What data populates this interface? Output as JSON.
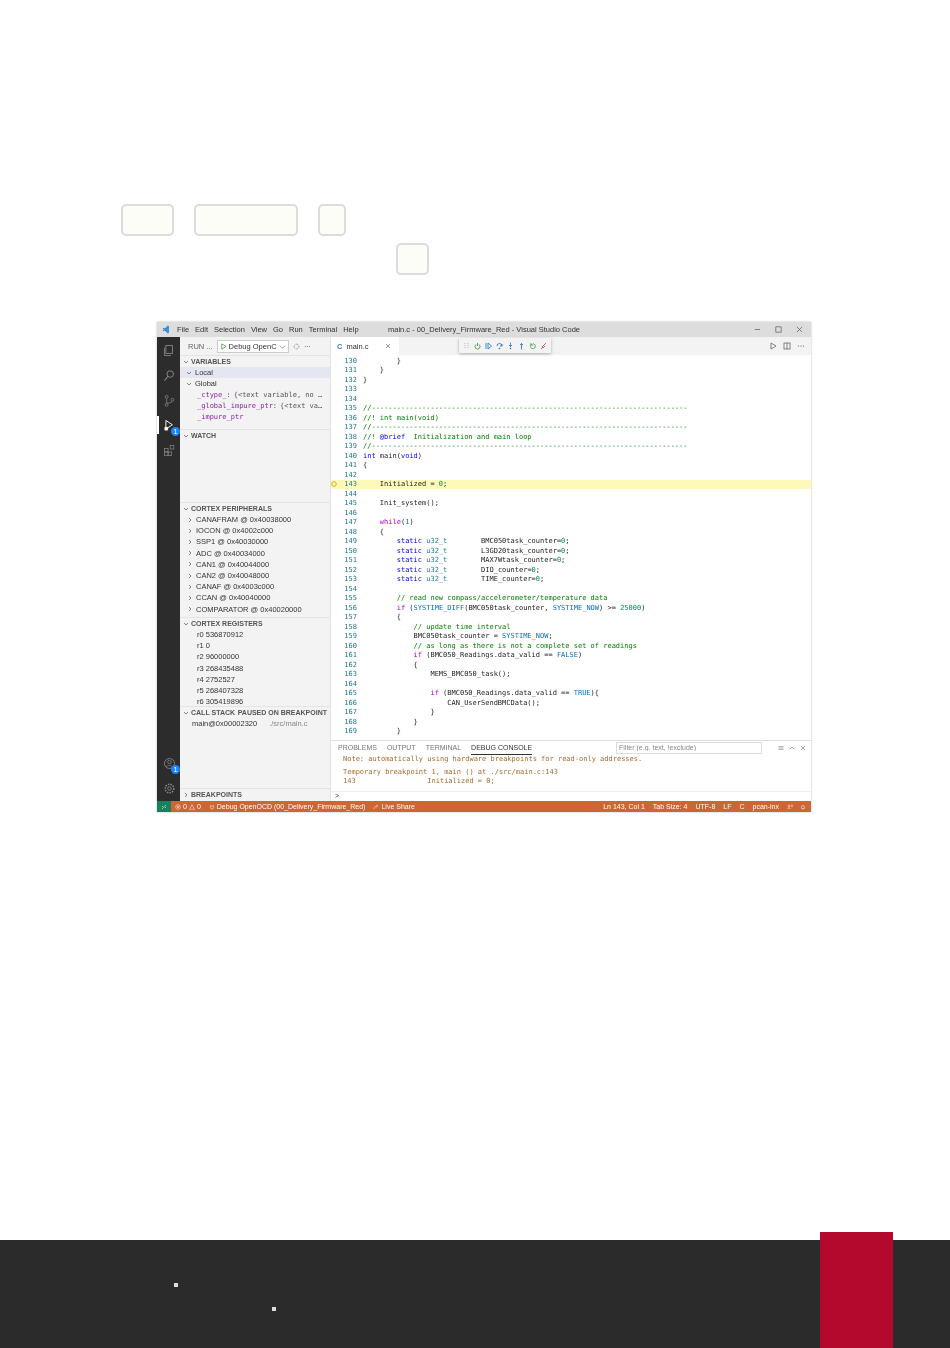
{
  "window": {
    "title": "main.c - 00_Delivery_Firmware_Red - Visual Studio Code",
    "menu": [
      "File",
      "Edit",
      "Selection",
      "View",
      "Go",
      "Run",
      "Terminal",
      "Help"
    ]
  },
  "activity_bar": {
    "top": [
      {
        "kind": "explorer",
        "selected": false
      },
      {
        "kind": "search",
        "selected": false
      },
      {
        "kind": "source-control",
        "selected": false
      },
      {
        "kind": "run-debug",
        "selected": true,
        "badge": "1"
      },
      {
        "kind": "extensions",
        "selected": false
      }
    ],
    "bottom": [
      {
        "kind": "accounts",
        "selected": false,
        "badge": "1"
      },
      {
        "kind": "settings",
        "selected": false
      }
    ]
  },
  "sidebar": {
    "title": "RUN ...",
    "config": "Debug OpenC",
    "sections": [
      {
        "kind": "variables",
        "title": "VARIABLES",
        "expanded": true,
        "items": [
          {
            "label": "Local",
            "expanded": true
          },
          {
            "label": "Global",
            "expanded": true,
            "children": [
              {
                "name": "_ctype_:",
                "value": "{<text variable, no …"
              },
              {
                "name": "_global_impure_ptr:",
                "value": "{<text va…"
              },
              {
                "name": "_impure_ptr"
              }
            ]
          }
        ]
      },
      {
        "kind": "watch",
        "title": "WATCH",
        "expanded": true
      },
      {
        "kind": "tree",
        "title": "CORTEX PERIPHERALS",
        "expanded": true,
        "items": [
          {
            "label": "CANAFRAM @ 0x40038000",
            "expanded": false
          },
          {
            "label": "IOCON @ 0x4002c000",
            "expanded": false
          },
          {
            "label": "SSP1 @ 0x40030000",
            "expanded": false
          },
          {
            "label": "ADC @ 0x40034000",
            "expanded": false
          },
          {
            "label": "CAN1 @ 0x40044000",
            "expanded": false
          },
          {
            "label": "CAN2 @ 0x40048000",
            "expanded": false
          },
          {
            "label": "CANAF @ 0x4003c000",
            "expanded": false
          },
          {
            "label": "CCAN @ 0x40040000",
            "expanded": false
          },
          {
            "label": "COMPARATOR @ 0x40020000",
            "expanded": false
          }
        ]
      },
      {
        "kind": "registers",
        "title": "CORTEX REGISTERS",
        "expanded": true,
        "items": [
          {
            "label": "r0 536870912"
          },
          {
            "label": "r1 0"
          },
          {
            "label": "r2 96000000"
          },
          {
            "label": "r3 268435488"
          },
          {
            "label": "r4 2752527"
          },
          {
            "label": "r5 268407328"
          },
          {
            "label": "r6 305419896"
          }
        ]
      },
      {
        "kind": "call-stack",
        "title": "CALL STACK",
        "expanded": true,
        "status": "PAUSED ON BREAKPOINT",
        "frames": [
          {
            "function": "main@0x00002320",
            "file": "./src/main.c"
          }
        ]
      },
      {
        "kind": "breakpoints",
        "title": "BREAKPOINTS",
        "expanded": false
      }
    ]
  },
  "editor": {
    "tab": {
      "language": "C",
      "label": "main.c"
    },
    "lines": [
      {
        "number": "130",
        "current": false,
        "segments": [
          {
            "kind": "plain",
            "text": "        }"
          }
        ]
      },
      {
        "number": "131",
        "current": false,
        "segments": [
          {
            "kind": "plain",
            "text": "    }"
          }
        ]
      },
      {
        "number": "132",
        "current": false,
        "segments": [
          {
            "kind": "plain",
            "text": "}"
          }
        ]
      },
      {
        "number": "133",
        "current": false
      },
      {
        "number": "134",
        "current": false
      },
      {
        "number": "135",
        "current": false,
        "segments": [
          {
            "kind": "comment",
            "text": "//---------------------------------------------------------------------------"
          }
        ]
      },
      {
        "number": "136",
        "current": false,
        "segments": [
          {
            "kind": "comment",
            "text": "//! int main(void)"
          }
        ]
      },
      {
        "number": "137",
        "current": false,
        "segments": [
          {
            "kind": "comment",
            "text": "//---------------------------------------------------------------------------"
          }
        ]
      },
      {
        "number": "138",
        "current": false,
        "segments": [
          {
            "kind": "comment",
            "text": "//! "
          },
          {
            "kind": "doc-tag",
            "text": "@brief"
          },
          {
            "kind": "comment",
            "text": "  Initialization and main loop"
          }
        ]
      },
      {
        "number": "139",
        "current": false,
        "segments": [
          {
            "kind": "comment",
            "text": "//---------------------------------------------------------------------------"
          }
        ]
      },
      {
        "number": "140",
        "current": false,
        "segments": [
          {
            "kind": "keyword",
            "text": "int"
          },
          {
            "kind": "plain",
            "text": " main("
          },
          {
            "kind": "keyword",
            "text": "void"
          },
          {
            "kind": "plain",
            "text": ")"
          }
        ]
      },
      {
        "number": "141",
        "current": false,
        "segments": [
          {
            "kind": "plain",
            "text": "{"
          }
        ]
      },
      {
        "number": "142",
        "current": false
      },
      {
        "number": "143",
        "current": true,
        "segments": [
          {
            "kind": "plain",
            "text": "    Initialized = "
          },
          {
            "kind": "number",
            "text": "0"
          },
          {
            "kind": "plain",
            "text": ";"
          }
        ]
      },
      {
        "number": "144",
        "current": false
      },
      {
        "number": "145",
        "current": false,
        "segments": [
          {
            "kind": "plain",
            "text": "    Init_system();"
          }
        ]
      },
      {
        "number": "146",
        "current": false
      },
      {
        "number": "147",
        "current": false,
        "segments": [
          {
            "kind": "control",
            "text": "    while"
          },
          {
            "kind": "plain",
            "text": "("
          },
          {
            "kind": "number",
            "text": "1"
          },
          {
            "kind": "plain",
            "text": ")"
          }
        ]
      },
      {
        "number": "148",
        "current": false,
        "segments": [
          {
            "kind": "plain",
            "text": "    {"
          }
        ]
      },
      {
        "number": "149",
        "current": false,
        "segments": [
          {
            "kind": "keyword",
            "text": "        static"
          },
          {
            "kind": "type",
            "text": " u32_t"
          },
          {
            "kind": "plain",
            "text": "        BMC050task_counter="
          },
          {
            "kind": "number",
            "text": "0"
          },
          {
            "kind": "plain",
            "text": ";"
          }
        ]
      },
      {
        "number": "150",
        "current": false,
        "segments": [
          {
            "kind": "keyword",
            "text": "        static"
          },
          {
            "kind": "type",
            "text": " u32_t"
          },
          {
            "kind": "plain",
            "text": "        L3GD20task_counter="
          },
          {
            "kind": "number",
            "text": "0"
          },
          {
            "kind": "plain",
            "text": ";"
          }
        ]
      },
      {
        "number": "151",
        "current": false,
        "segments": [
          {
            "kind": "keyword",
            "text": "        static"
          },
          {
            "kind": "type",
            "text": " u32_t"
          },
          {
            "kind": "plain",
            "text": "        MAX7Wtask_counter="
          },
          {
            "kind": "number",
            "text": "0"
          },
          {
            "kind": "plain",
            "text": ";"
          }
        ]
      },
      {
        "number": "152",
        "current": false,
        "segments": [
          {
            "kind": "keyword",
            "text": "        static"
          },
          {
            "kind": "type",
            "text": " u32_t"
          },
          {
            "kind": "plain",
            "text": "        DIO_counter="
          },
          {
            "kind": "number",
            "text": "0"
          },
          {
            "kind": "plain",
            "text": ";"
          }
        ]
      },
      {
        "number": "153",
        "current": false,
        "segments": [
          {
            "kind": "keyword",
            "text": "        static"
          },
          {
            "kind": "type",
            "text": " u32_t"
          },
          {
            "kind": "plain",
            "text": "        TIME_counter="
          },
          {
            "kind": "number",
            "text": "0"
          },
          {
            "kind": "plain",
            "text": ";"
          }
        ]
      },
      {
        "number": "154",
        "current": false
      },
      {
        "number": "155",
        "current": false,
        "segments": [
          {
            "kind": "comment",
            "text": "        // read new compass/accelerometer/temperature data"
          }
        ]
      },
      {
        "number": "156",
        "current": false,
        "segments": [
          {
            "kind": "control",
            "text": "        if"
          },
          {
            "kind": "plain",
            "text": " ("
          },
          {
            "kind": "constant",
            "text": "SYSTIME_DIFF"
          },
          {
            "kind": "plain",
            "text": "(BMC050task_counter, "
          },
          {
            "kind": "constant",
            "text": "SYSTIME_NOW"
          },
          {
            "kind": "plain",
            "text": ") >= "
          },
          {
            "kind": "number",
            "text": "25000"
          },
          {
            "kind": "plain",
            "text": ")"
          }
        ]
      },
      {
        "number": "157",
        "current": false,
        "segments": [
          {
            "kind": "plain",
            "text": "        {"
          }
        ]
      },
      {
        "number": "158",
        "current": false,
        "segments": [
          {
            "kind": "comment",
            "text": "            // update time interval"
          }
        ]
      },
      {
        "number": "159",
        "current": false,
        "segments": [
          {
            "kind": "plain",
            "text": "            BMC050task_counter = "
          },
          {
            "kind": "constant",
            "text": "SYSTIME_NOW"
          },
          {
            "kind": "plain",
            "text": ";"
          }
        ]
      },
      {
        "number": "160",
        "current": false,
        "segments": [
          {
            "kind": "comment",
            "text": "            // as long as there is not a complete set of readings"
          }
        ]
      },
      {
        "number": "161",
        "current": false,
        "segments": [
          {
            "kind": "control",
            "text": "            if"
          },
          {
            "kind": "plain",
            "text": " (BMC050_Readings.data_valid == "
          },
          {
            "kind": "constant",
            "text": "FALSE"
          },
          {
            "kind": "plain",
            "text": ")"
          }
        ]
      },
      {
        "number": "162",
        "current": false,
        "segments": [
          {
            "kind": "plain",
            "text": "            {"
          }
        ]
      },
      {
        "number": "163",
        "current": false,
        "segments": [
          {
            "kind": "plain",
            "text": "                MEMS_BMC050_task();"
          }
        ]
      },
      {
        "number": "164",
        "current": false
      },
      {
        "number": "165",
        "current": false,
        "segments": [
          {
            "kind": "control",
            "text": "                if"
          },
          {
            "kind": "plain",
            "text": " (BMC050_Readings.data_valid == "
          },
          {
            "kind": "constant",
            "text": "TRUE"
          },
          {
            "kind": "plain",
            "text": "){"
          }
        ]
      },
      {
        "number": "166",
        "current": false,
        "segments": [
          {
            "kind": "plain",
            "text": "                    CAN_UserSendBMCData();"
          }
        ]
      },
      {
        "number": "167",
        "current": false,
        "segments": [
          {
            "kind": "plain",
            "text": "                }"
          }
        ]
      },
      {
        "number": "168",
        "current": false,
        "segments": [
          {
            "kind": "plain",
            "text": "            }"
          }
        ]
      },
      {
        "number": "169",
        "current": false,
        "segments": [
          {
            "kind": "plain",
            "text": "        }"
          }
        ]
      }
    ]
  },
  "panel": {
    "tabs": [
      {
        "label": "PROBLEMS",
        "selected": false
      },
      {
        "label": "OUTPUT",
        "selected": false
      },
      {
        "label": "TERMINAL",
        "selected": false
      },
      {
        "label": "DEBUG CONSOLE",
        "selected": true
      }
    ],
    "filter": {
      "placeholder": "Filter (e.g. text, !exclude)"
    },
    "console": [
      "Note: automatically using hardware breakpoints for read-only addresses.",
      "Temporary breakpoint 1, main () at ./src/main.c:143",
      "143\t            Initialized = 0;"
    ],
    "prompt": ">"
  },
  "status_bar": {
    "errors": "0",
    "warnings": "0",
    "debug_config": "Debug OpenOCD (00_Delivery_Firmware_Red)",
    "live_share": "Live Share",
    "right": [
      "Ln 143, Col 1",
      "Tab Size: 4",
      "UTF-8",
      "LF",
      "C",
      "pcan-lnx"
    ]
  }
}
